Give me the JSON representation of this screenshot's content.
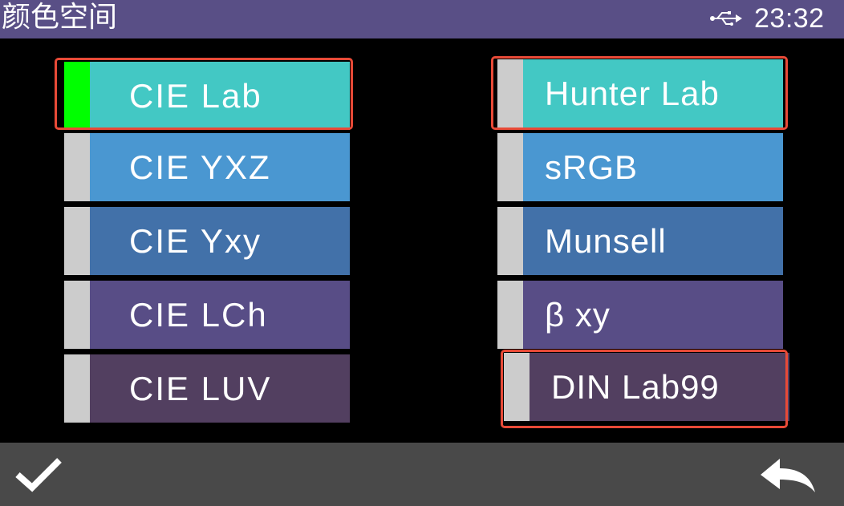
{
  "header": {
    "title": "颜色空间",
    "usb_icon": "usb-icon",
    "time": "23:32"
  },
  "colors": {
    "highlight": "#e84a37",
    "selected_marker": "#00ff00",
    "marker": "#cccccc"
  },
  "left_column": [
    {
      "label": "CIE Lab",
      "color": "#43c8c4",
      "selected": true
    },
    {
      "label": "CIE YXZ",
      "color": "#4a97d1"
    },
    {
      "label": "CIE Yxy",
      "color": "#4271a9"
    },
    {
      "label": "CIE LCh",
      "color": "#584d86"
    },
    {
      "label": "CIE LUV",
      "color": "#523f60"
    }
  ],
  "right_column": [
    {
      "label": "Hunter Lab",
      "color": "#43c8c4"
    },
    {
      "label": "sRGB",
      "color": "#4a97d1"
    },
    {
      "label": "Munsell",
      "color": "#4271a9"
    },
    {
      "label": "β xy",
      "color": "#584d86"
    },
    {
      "label": "DIN Lab99",
      "color": "#523f60"
    }
  ],
  "footer": {
    "confirm_icon": "checkmark-icon",
    "back_icon": "return-arrow-icon"
  }
}
